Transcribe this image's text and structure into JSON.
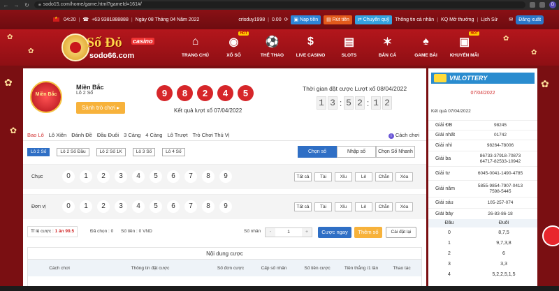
{
  "browser": {
    "url": "sodo15.com/home/game.html?gameId=161#/",
    "profile": "D"
  },
  "topbar": {
    "time": "04:20",
    "phone": "+63 9381888888",
    "date": "Ngày 08 Tháng 04 Năm 2022",
    "user": "crisduy1998",
    "balance": "0.00",
    "deposit": "Nạp tiền",
    "withdraw": "Rút tiền",
    "transfer": "Chuyển quỹ",
    "account": "Thông tin cá nhân",
    "results": "KQ Mở thưởng",
    "history": "Lịch Sử",
    "logout": "Đăng xuất"
  },
  "logo": {
    "name": "Số Đỏ",
    "badge": "casino",
    "domain": "sodo66.com"
  },
  "nav": {
    "items": [
      {
        "label": "TRANG CHỦ",
        "icon": "home-icon",
        "glyph": "⌂",
        "hot": ""
      },
      {
        "label": "XỔ SỐ",
        "icon": "lottery-ball-icon",
        "glyph": "◉",
        "hot": "HOT"
      },
      {
        "label": "THỂ THAO",
        "icon": "soccer-ball-icon",
        "glyph": "⚽",
        "hot": ""
      },
      {
        "label": "LIVE CASINO",
        "icon": "casino-chip-icon",
        "glyph": "$",
        "hot": ""
      },
      {
        "label": "SLOTS",
        "icon": "slot-machine-icon",
        "glyph": "▤",
        "hot": ""
      },
      {
        "label": "BẮN CÁ",
        "icon": "fish-icon",
        "glyph": "✶",
        "hot": ""
      },
      {
        "label": "GAME BÀI",
        "icon": "cards-icon",
        "glyph": "♠",
        "hot": ""
      },
      {
        "label": "KHUYẾN MÃI",
        "icon": "gift-icon",
        "glyph": "▣",
        "hot": "HOT"
      }
    ]
  },
  "game": {
    "region_badge": "Miền Bắc",
    "title": "Miền Bắc",
    "subtitle": "Lô 2 Số",
    "switch_button": "Sảnh trò chơi",
    "balls": [
      "9",
      "8",
      "2",
      "4",
      "5"
    ],
    "result_label": "Kết quả lượt xổ 07/04/2022",
    "bet_time_label": "Thời gian đặt cược Lượt xổ 08/04/2022",
    "countdown": [
      "1",
      "3",
      ":",
      "5",
      "2",
      ":",
      "1",
      "2"
    ]
  },
  "tabs": [
    "Bao Lô",
    "Lô Xiên",
    "Đánh Đề",
    "Đầu Đuôi",
    "3 Càng",
    "4 Càng",
    "Lô Trượt",
    "Trò Chơi Thú Vị"
  ],
  "howto": "Cách chơi",
  "subtabs": [
    "Lô 2 Số",
    "Lô 2 Số Đầu",
    "Lô 2 Số 1K",
    "Lô 3 Số",
    "Lô 4 Số"
  ],
  "modes": [
    "Chọn số",
    "Nhập số",
    "Chọn Số Nhanh"
  ],
  "rows": [
    {
      "label": "Chục",
      "numbers": [
        "0",
        "1",
        "2",
        "3",
        "4",
        "5",
        "6",
        "7",
        "8",
        "9"
      ]
    },
    {
      "label": "Đơn vị",
      "numbers": [
        "0",
        "1",
        "2",
        "3",
        "4",
        "5",
        "6",
        "7",
        "8",
        "9"
      ]
    }
  ],
  "quick": [
    "Tất cả",
    "Tài",
    "Xỉu",
    "Lẻ",
    "Chẵn",
    "Xóa"
  ],
  "betbar": {
    "ratio_label": "Tỉ lệ cược :",
    "ratio_value": "1 ăn 99.5",
    "chosen": "Đã chọn : 0",
    "amount": "Số tiền : 0 VND",
    "multiplier_label": "Số nhân",
    "multiplier_value": "1",
    "bet_now": "Cược ngay",
    "add_number": "Thêm số",
    "reset": "Cài đặt lại"
  },
  "content": {
    "title": "Nội dung cược",
    "columns": [
      "Cách chơi",
      "Thông tin đặt cược",
      "Số đơn cược",
      "Cấp số nhân",
      "Số tiền cược",
      "Tiền thắng /1 lần",
      "Thao tác"
    ]
  },
  "right": {
    "banner": "VNLOTTERY",
    "date": "07/04/2022",
    "result_label": "Kết quả 07/04/2022",
    "prizes": [
      {
        "name": "Giải ĐB",
        "value": "98245"
      },
      {
        "name": "Giải nhất",
        "value": "01742"
      },
      {
        "name": "Giải nhì",
        "value": "98264-78006"
      },
      {
        "name": "Giải ba",
        "value": "86733-37918-70873\n64717-82533-10942"
      },
      {
        "name": "Giải tư",
        "value": "6045-0041-1490-4785"
      },
      {
        "name": "Giải năm",
        "value": "5855-9854-7907-0413\n7598-5445"
      },
      {
        "name": "Giải sáu",
        "value": "105-257-074"
      },
      {
        "name": "Giải bảy",
        "value": "26-83-86-18"
      }
    ],
    "dd_headers": [
      "Đầu",
      "Đuôi"
    ],
    "dd_rows": [
      {
        "head": "0",
        "tail": "8,7,5"
      },
      {
        "head": "1",
        "tail": "9,7,3,8"
      },
      {
        "head": "2",
        "tail": "6"
      },
      {
        "head": "3",
        "tail": "3,3"
      },
      {
        "head": "4",
        "tail": "5,2,2,5,1,5"
      }
    ]
  },
  "colors": {
    "brand_red": "#b4161c",
    "ball_red": "#d6262a",
    "accent_blue": "#2f6fc5",
    "accent_orange": "#f7b23b"
  }
}
